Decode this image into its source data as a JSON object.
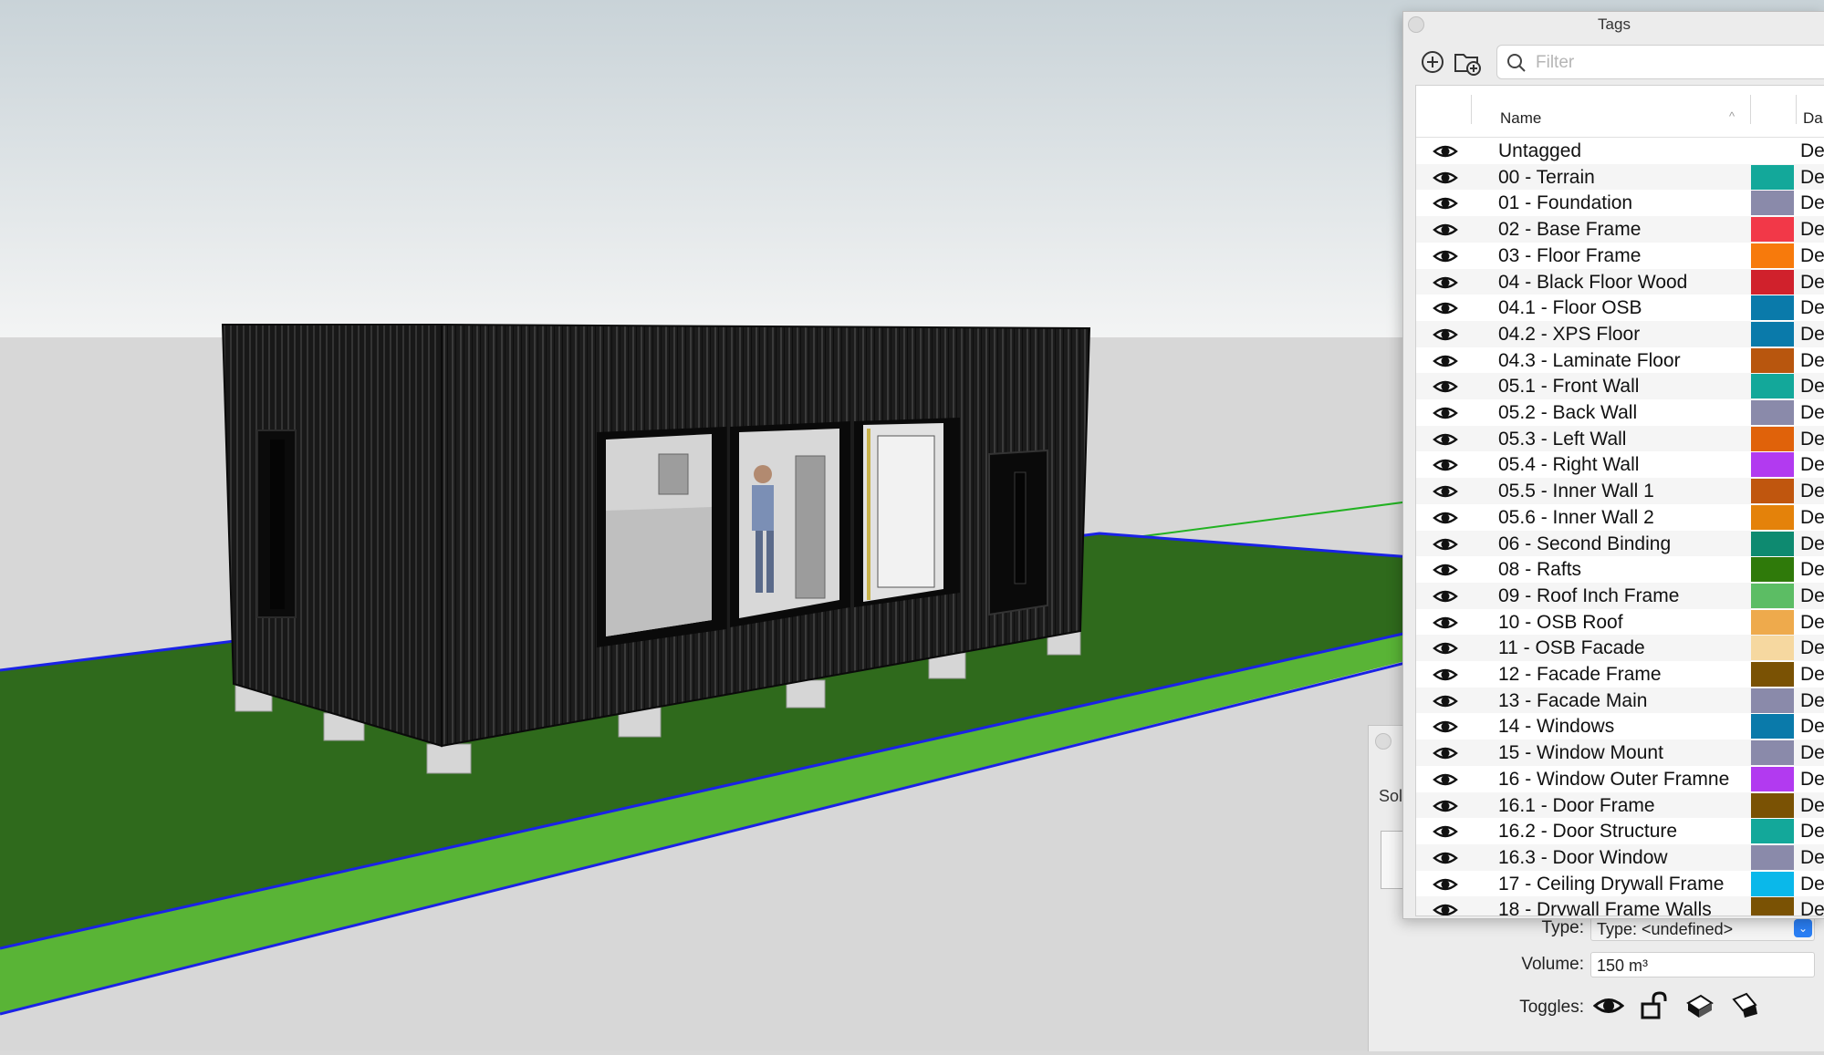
{
  "tags_panel": {
    "title": "Tags",
    "filter_placeholder": "Filter",
    "columns": {
      "name": "Name",
      "dash": "Da"
    },
    "rows": [
      {
        "name": "Untagged",
        "color": null,
        "dash": "De"
      },
      {
        "name": "00 - Terrain",
        "color": "#13a89a",
        "dash": "De"
      },
      {
        "name": "01 - Foundation",
        "color": "#8a8aaa",
        "dash": "De"
      },
      {
        "name": "02 - Base Frame",
        "color": "#f23848",
        "dash": "De"
      },
      {
        "name": "03 - Floor Frame",
        "color": "#f77a0c",
        "dash": "De"
      },
      {
        "name": "04 - Black Floor Wood",
        "color": "#d0212c",
        "dash": "De"
      },
      {
        "name": "04.1 - Floor OSB",
        "color": "#0a7aaa",
        "dash": "De"
      },
      {
        "name": "04.2 - XPS Floor",
        "color": "#0a7aaa",
        "dash": "De"
      },
      {
        "name": "04.3 - Laminate Floor",
        "color": "#b8560e",
        "dash": "De"
      },
      {
        "name": "05.1 - Front Wall",
        "color": "#13a89a",
        "dash": "De"
      },
      {
        "name": "05.2 - Back Wall",
        "color": "#8a8aaa",
        "dash": "De"
      },
      {
        "name": "05.3 - Left Wall",
        "color": "#e0620a",
        "dash": "De"
      },
      {
        "name": "05.4 - Right Wall",
        "color": "#b23af0",
        "dash": "De"
      },
      {
        "name": "05.5 - Inner Wall 1",
        "color": "#c0560e",
        "dash": "De"
      },
      {
        "name": "05.6 - Inner Wall 2",
        "color": "#e4820a",
        "dash": "De"
      },
      {
        "name": "06 - Second Binding",
        "color": "#0e8a70",
        "dash": "De"
      },
      {
        "name": "08 - Rafts",
        "color": "#2f7a0a",
        "dash": "De"
      },
      {
        "name": "09 - Roof Inch Frame",
        "color": "#5cbd64",
        "dash": "De"
      },
      {
        "name": "10 - OSB Roof",
        "color": "#eeaa4c",
        "dash": "De"
      },
      {
        "name": "11 - OSB Facade",
        "color": "#f6d8a0",
        "dash": "De"
      },
      {
        "name": "12 - Facade Frame",
        "color": "#7a5204",
        "dash": "De"
      },
      {
        "name": "13 - Facade Main",
        "color": "#8a8aaa",
        "dash": "De"
      },
      {
        "name": "14 - Windows",
        "color": "#0a7aaa",
        "dash": "De"
      },
      {
        "name": "15 - Window Mount",
        "color": "#8a8aaa",
        "dash": "De"
      },
      {
        "name": "16 - Window Outer Framne",
        "color": "#b23af0",
        "dash": "De"
      },
      {
        "name": "16.1 - Door Frame",
        "color": "#7a5204",
        "dash": "De"
      },
      {
        "name": "16.2 - Door Structure",
        "color": "#13a89a",
        "dash": "De"
      },
      {
        "name": "16.3 - Door Window",
        "color": "#8a8aaa",
        "dash": "De"
      },
      {
        "name": "17 - Ceiling Drywall Frame",
        "color": "#0ab8ea",
        "dash": "De"
      },
      {
        "name": "18 - Drywall Frame Walls",
        "color": "#7a5204",
        "dash": "De"
      }
    ]
  },
  "entity_info": {
    "tab_label": "Sol",
    "type_label": "Type:",
    "type_value": "Type: <undefined>",
    "volume_label": "Volume:",
    "volume_value": "150 m³",
    "toggles_label": "Toggles:"
  }
}
